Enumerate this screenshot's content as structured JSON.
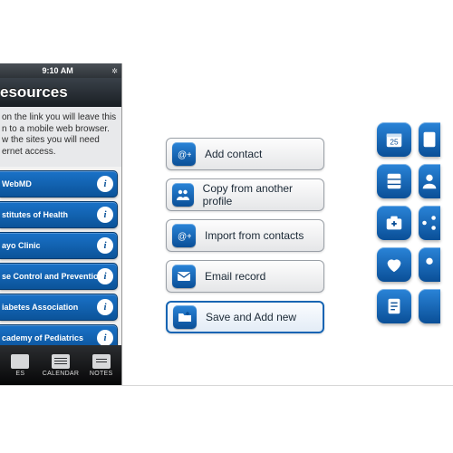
{
  "phone": {
    "status": {
      "time": "9:10 AM",
      "bluetooth": "⧩"
    },
    "title": "esources",
    "instructions": "on the link you will leave this n to a mobile web browser. w the sites you will need ernet access.",
    "resources": [
      {
        "label": "WebMD"
      },
      {
        "label": "stitutes of Health"
      },
      {
        "label": "ayo Clinic"
      },
      {
        "label": "se Control and Prevention"
      },
      {
        "label": "iabetes Association"
      },
      {
        "label": "cademy of Pediatrics"
      }
    ],
    "info_glyph": "i",
    "tabs": [
      {
        "label": "ES"
      },
      {
        "label": "CALENDAR"
      },
      {
        "label": "NOTES"
      }
    ]
  },
  "actions": [
    {
      "id": "add-contact",
      "label": "Add contact",
      "icon": "at-plus"
    },
    {
      "id": "copy-profile",
      "label": "Copy from another profile",
      "icon": "people"
    },
    {
      "id": "import-contacts",
      "label": "Import from contacts",
      "icon": "at-plus"
    },
    {
      "id": "email-record",
      "label": "Email record",
      "icon": "envelope"
    },
    {
      "id": "save-add-new",
      "label": "Save and Add new",
      "icon": "folder-plus",
      "primary": true
    }
  ],
  "icon_grid": [
    "calendar",
    "clipboard",
    "cabinet",
    "user",
    "medkit",
    "share",
    "heart",
    "person",
    "notes",
    "blank"
  ],
  "colors": {
    "blue_top": "#2a84d8",
    "blue_bottom": "#0a4f97"
  }
}
